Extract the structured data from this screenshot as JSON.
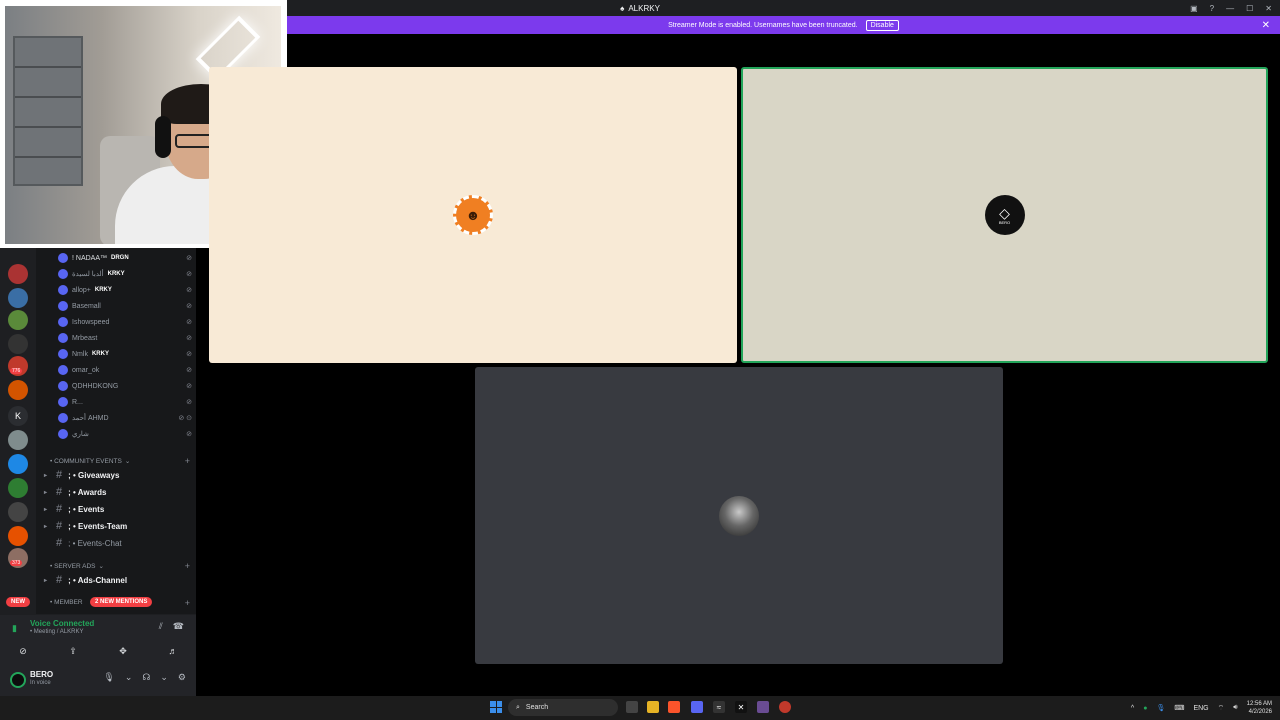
{
  "window": {
    "title": "ALKRKY"
  },
  "banner": {
    "text": "Streamer Mode is enabled. Usernames have been truncated.",
    "button": "Disable"
  },
  "members": [
    {
      "name": "! NADAA™",
      "tag": "DRGN"
    },
    {
      "name": "ألدبا لسيدة",
      "tag": "KRKY"
    },
    {
      "name": "allop+",
      "tag": "KRKY"
    },
    {
      "name": "Basemall",
      "tag": ""
    },
    {
      "name": "Ishowspeed",
      "tag": ""
    },
    {
      "name": "Mrbeast",
      "tag": ""
    },
    {
      "name": "Nmlk",
      "tag": "KRKY"
    },
    {
      "name": "omar_ok",
      "tag": ""
    },
    {
      "name": "QDHHDKONG",
      "tag": ""
    },
    {
      "name": "R...",
      "tag": ""
    },
    {
      "name": "أحمد AHMD",
      "tag": ""
    },
    {
      "name": "شاري",
      "tag": ""
    }
  ],
  "categories": {
    "community": "• COMMUNITY EVENTS",
    "server_ads": "• SERVER ADS",
    "members": "• MEMBER"
  },
  "channels": {
    "giveaways": "; • Giveaways",
    "awards": "; • Awards",
    "events": "; • Events",
    "events_team": "; • Events-Team",
    "events_chat": "; • Events-Chat",
    "ads_channel": "; • Ads-Channel"
  },
  "badges": {
    "new": "NEW",
    "mentions": "2 NEW MENTIONS",
    "guild_count_1": "776",
    "guild_count_2": "373"
  },
  "guild_letter": "K",
  "voice": {
    "title": "Voice Connected",
    "channel": "• Meeting / ALKRKY"
  },
  "user": {
    "name": "BERO",
    "status": "In voice"
  },
  "tiles": {
    "tile2_label": "BERO"
  },
  "taskbar": {
    "search": "Search",
    "lang": "ENG",
    "time": "12:56 AM",
    "date": "4/2/2026"
  },
  "colors": {
    "accent": "#7c3aed",
    "voice_green": "#23a55a",
    "danger": "#f23f43"
  }
}
